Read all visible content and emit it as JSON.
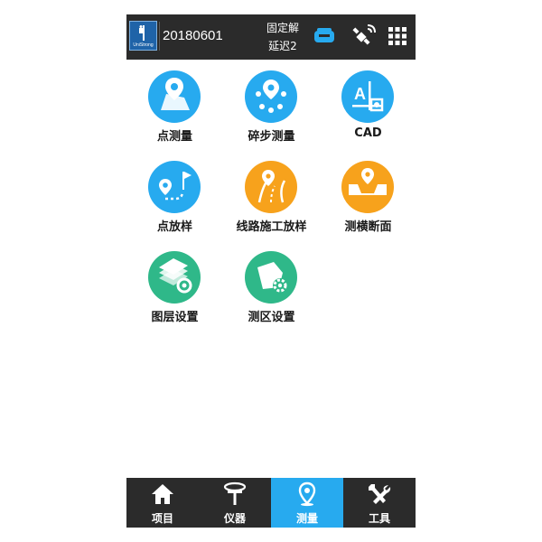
{
  "header": {
    "logo_text": "UniStrong",
    "project_name": "20180601",
    "solution_status": "固定解",
    "latency": "延迟2",
    "icons": [
      "receiver-icon",
      "satellite-icon",
      "grid-menu-icon"
    ]
  },
  "menu": {
    "items": [
      {
        "label": "点测量",
        "icon": "point-survey-icon",
        "color": "#27aaef"
      },
      {
        "label": "碎步测量",
        "icon": "detail-survey-icon",
        "color": "#27aaef"
      },
      {
        "label": "CAD",
        "icon": "cad-icon",
        "color": "#27aaef"
      },
      {
        "label": "点放样",
        "icon": "point-stakeout-icon",
        "color": "#27aaef"
      },
      {
        "label": "线路施工放样",
        "icon": "road-stakeout-icon",
        "color": "#f7a21c"
      },
      {
        "label": "测横断面",
        "icon": "cross-section-icon",
        "color": "#f7a21c"
      },
      {
        "label": "图层设置",
        "icon": "layer-settings-icon",
        "color": "#2fb889"
      },
      {
        "label": "测区设置",
        "icon": "area-settings-icon",
        "color": "#2fb889"
      }
    ]
  },
  "bottom_nav": {
    "active_color": "#27aaef",
    "items": [
      {
        "label": "项目",
        "icon": "home-icon",
        "active": false
      },
      {
        "label": "仪器",
        "icon": "instrument-icon",
        "active": false
      },
      {
        "label": "测量",
        "icon": "location-pin-icon",
        "active": true
      },
      {
        "label": "工具",
        "icon": "tools-icon",
        "active": false
      }
    ]
  }
}
